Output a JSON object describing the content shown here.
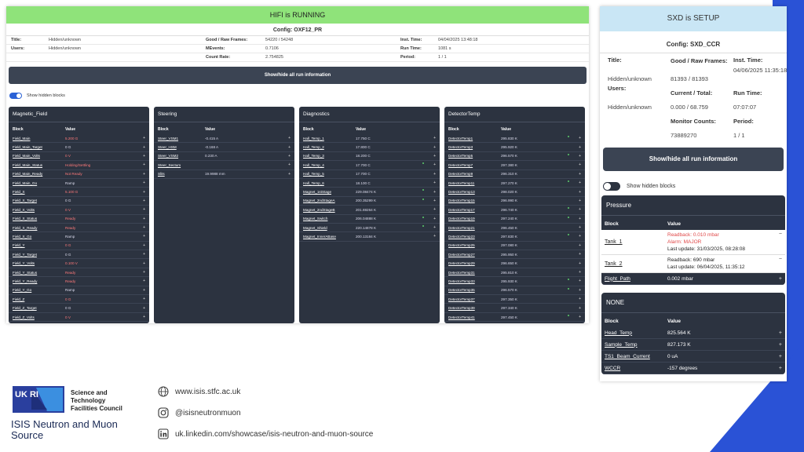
{
  "hifi": {
    "status": "HIFI is RUNNING",
    "config": "Config: OXF12_PR",
    "info": {
      "title_label": "Title:",
      "title_value": "Hidden/unknown",
      "users_label": "Users:",
      "users_value": "Hidden/unknown",
      "frames_label": "Good / Raw Frames:",
      "frames_value": "54220 / 54248",
      "mevents_label": "MEvents:",
      "mevents_value": "0.7106",
      "countrate_label": "Count Rate:",
      "countrate_value": "2.754825",
      "insttime_label": "Inst. Time:",
      "insttime_value": "04/04/2025 13:48:18",
      "runtime_label": "Run Time:",
      "runtime_value": "1081 s",
      "period_label": "Period:",
      "period_value": "1 / 1"
    },
    "toggle_button": "Show/hide all run information",
    "show_hidden": "Show hidden blocks",
    "groups": [
      {
        "title": "Magnetic_Field",
        "block_header": "Block",
        "value_header": "Value",
        "rows": [
          {
            "name": "Field_Main",
            "value": "5.200 G",
            "alarm": true
          },
          {
            "name": "Field_Main_Target",
            "value": "0 G",
            "alarm": false
          },
          {
            "name": "Field_Main_Volts",
            "value": "0 V",
            "alarm": true
          },
          {
            "name": "Field_Main_Status",
            "value": "Holding/Settling",
            "alarm": true
          },
          {
            "name": "Field_Main_Ready",
            "value": "Not Ready",
            "alarm": true
          },
          {
            "name": "Field_Main_Go",
            "value": "Ramp",
            "alarm": false
          },
          {
            "name": "Field_X",
            "value": "5.100 G",
            "alarm": true
          },
          {
            "name": "Field_X_Target",
            "value": "0 G",
            "alarm": false
          },
          {
            "name": "Field_X_Volts",
            "value": "0 V",
            "alarm": true
          },
          {
            "name": "Field_X_Status",
            "value": "Ready",
            "alarm": true
          },
          {
            "name": "Field_X_Ready",
            "value": "Ready",
            "alarm": true
          },
          {
            "name": "Field_X_Go",
            "value": "Ramp",
            "alarm": false
          },
          {
            "name": "Field_Y",
            "value": "0 G",
            "alarm": true
          },
          {
            "name": "Field_Y_Target",
            "value": "0 G",
            "alarm": false
          },
          {
            "name": "Field_Y_Volts",
            "value": "0.100 V",
            "alarm": true
          },
          {
            "name": "Field_Y_Status",
            "value": "Ready",
            "alarm": true
          },
          {
            "name": "Field_Y_Ready",
            "value": "Ready",
            "alarm": true
          },
          {
            "name": "Field_Y_Go",
            "value": "Ramp",
            "alarm": false
          },
          {
            "name": "Field_Z",
            "value": "0 G",
            "alarm": true
          },
          {
            "name": "Field_Z_Target",
            "value": "0 G",
            "alarm": false
          },
          {
            "name": "Field_Z_Volts",
            "value": "0 V",
            "alarm": true
          }
        ]
      },
      {
        "title": "Steering",
        "block_header": "Block",
        "value_header": "Value",
        "rows": [
          {
            "name": "Steer_VSM1",
            "value": "-0.415 A",
            "alarm": false
          },
          {
            "name": "Steer_HSM",
            "value": "-0.168 A",
            "alarm": false
          },
          {
            "name": "Steer_VSM2",
            "value": "0.230 A",
            "alarm": false
          },
          {
            "name": "Steer_Sectum",
            "value": "",
            "alarm": false
          },
          {
            "name": "Slits",
            "value": "19.9988 mm",
            "alarm": false
          }
        ]
      },
      {
        "title": "Diagnostics",
        "block_header": "Block",
        "value_header": "Value",
        "rows": [
          {
            "name": "Hall_Temp_1",
            "value": "17.750 C",
            "alarm": false
          },
          {
            "name": "Hall_Temp_2",
            "value": "17.800 C",
            "alarm": false
          },
          {
            "name": "Hall_Temp_3",
            "value": "18.200 C",
            "alarm": false
          },
          {
            "name": "Hall_Temp_4",
            "value": "17.700 C",
            "alarm": false
          },
          {
            "name": "Hall_Temp_5",
            "value": "17.700 C",
            "alarm": false
          },
          {
            "name": "Hall_Temp_6",
            "value": "18.100 C",
            "alarm": false
          },
          {
            "name": "Magnet_1stStage",
            "value": "229.08474 K",
            "alarm": false
          },
          {
            "name": "Magnet_2ndStageA",
            "value": "200.35299 K",
            "alarm": false
          },
          {
            "name": "Magnet_2ndStageB",
            "value": "201.69264 K",
            "alarm": false
          },
          {
            "name": "Magnet_Switch",
            "value": "206.04888 K",
            "alarm": false
          },
          {
            "name": "Magnet_Shield",
            "value": "220.14878 K",
            "alarm": false
          },
          {
            "name": "Magnet_InnerABase",
            "value": "200.13184 K",
            "alarm": false
          }
        ]
      },
      {
        "title": "DetectorTemp",
        "block_header": "Block",
        "value_header": "Value",
        "rows": [
          {
            "name": "DetectorTemp1",
            "value": "295.830 K",
            "alarm": false
          },
          {
            "name": "DetectorTemp3",
            "value": "295.920 K",
            "alarm": false
          },
          {
            "name": "DetectorTemp5",
            "value": "296.570 K",
            "alarm": false
          },
          {
            "name": "DetectorTemp7",
            "value": "297.380 K",
            "alarm": false
          },
          {
            "name": "DetectorTemp9",
            "value": "296.310 K",
            "alarm": false
          },
          {
            "name": "DetectorTemp11",
            "value": "297.270 K",
            "alarm": false
          },
          {
            "name": "DetectorTemp13",
            "value": "298.020 K",
            "alarm": false
          },
          {
            "name": "DetectorTemp15",
            "value": "296.990 K",
            "alarm": false
          },
          {
            "name": "DetectorTemp17",
            "value": "296.740 K",
            "alarm": false
          },
          {
            "name": "DetectorTemp19",
            "value": "297.240 K",
            "alarm": false
          },
          {
            "name": "DetectorTemp21",
            "value": "296.450 K",
            "alarm": false
          },
          {
            "name": "DetectorTemp23",
            "value": "297.830 K",
            "alarm": false
          },
          {
            "name": "DetectorTemp25",
            "value": "297.080 K",
            "alarm": false
          },
          {
            "name": "DetectorTemp27",
            "value": "295.950 K",
            "alarm": false
          },
          {
            "name": "DetectorTemp29",
            "value": "296.650 K",
            "alarm": false
          },
          {
            "name": "DetectorTemp31",
            "value": "295.810 K",
            "alarm": false
          },
          {
            "name": "DetectorTemp33",
            "value": "295.930 K",
            "alarm": false
          },
          {
            "name": "DetectorTemp35",
            "value": "296.570 K",
            "alarm": false
          },
          {
            "name": "DetectorTemp37",
            "value": "297.350 K",
            "alarm": false
          },
          {
            "name": "DetectorTemp39",
            "value": "297.340 K",
            "alarm": false
          },
          {
            "name": "DetectorTemp41",
            "value": "297.450 K",
            "alarm": false
          }
        ]
      }
    ]
  },
  "sxd": {
    "status": "SXD is SETUP",
    "config": "Config: SXD_CCR",
    "info": {
      "title_label": "Title:",
      "title_value": "Hidden/unknown",
      "users_label": "Users:",
      "users_value": "Hidden/unknown",
      "frames_label": "Good / Raw Frames:",
      "frames_value": "81393 / 81393",
      "current_label": "Current / Total:",
      "current_value": "0.000 / 68.759",
      "monitor_label": "Monitor Counts:",
      "monitor_value": "73889270",
      "insttime_label": "Inst. Time:",
      "insttime_value": "04/06/2025 11:35:18",
      "runtime_label": "Run Time:",
      "runtime_value": "07:07:07",
      "period_label": "Period:",
      "period_value": "1 / 1"
    },
    "toggle_button": "Show/hide all run information",
    "show_hidden": "Show hidden blocks",
    "pressure": {
      "title": "Pressure",
      "block_header": "Block",
      "value_header": "Value",
      "tank1": {
        "name": "Tank_1",
        "readback": "Readback: 0.010 mbar",
        "alarm": "Alarm: MAJOR",
        "update": "Last update: 31/03/2025, 08:28:08"
      },
      "tank2": {
        "name": "Tank_2",
        "readback": "Readback: 690 mbar",
        "update": "Last update: 06/04/2025, 11:35:12"
      },
      "flight": {
        "name": "Flight_Path",
        "value": "0.002 mbar"
      }
    },
    "none": {
      "title": "NONE",
      "block_header": "Block",
      "value_header": "Value",
      "rows": [
        {
          "name": "Head_Temp",
          "value": "825.564 K"
        },
        {
          "name": "Sample_Temp",
          "value": "827.173 K"
        },
        {
          "name": "TS1_Beam_Current",
          "value": "0 uA"
        },
        {
          "name": "WCCR",
          "value": "-157 degrees"
        }
      ]
    }
  },
  "footer": {
    "ukri": "UK RI",
    "stfc": "Science and Technology Facilities Council",
    "isis": "ISIS Neutron and Muon Source",
    "web": "www.isis.stfc.ac.uk",
    "instagram": "@isisneutronmuon",
    "linkedin": "uk.linkedin.com/showcase/isis-neutron-and-muon-source"
  },
  "colors": {
    "running": "#8fe37a",
    "setup": "#c9e6f5",
    "panel": "#2c3340",
    "alarm": "#ff7a7a",
    "brand": "#2a52d6"
  }
}
